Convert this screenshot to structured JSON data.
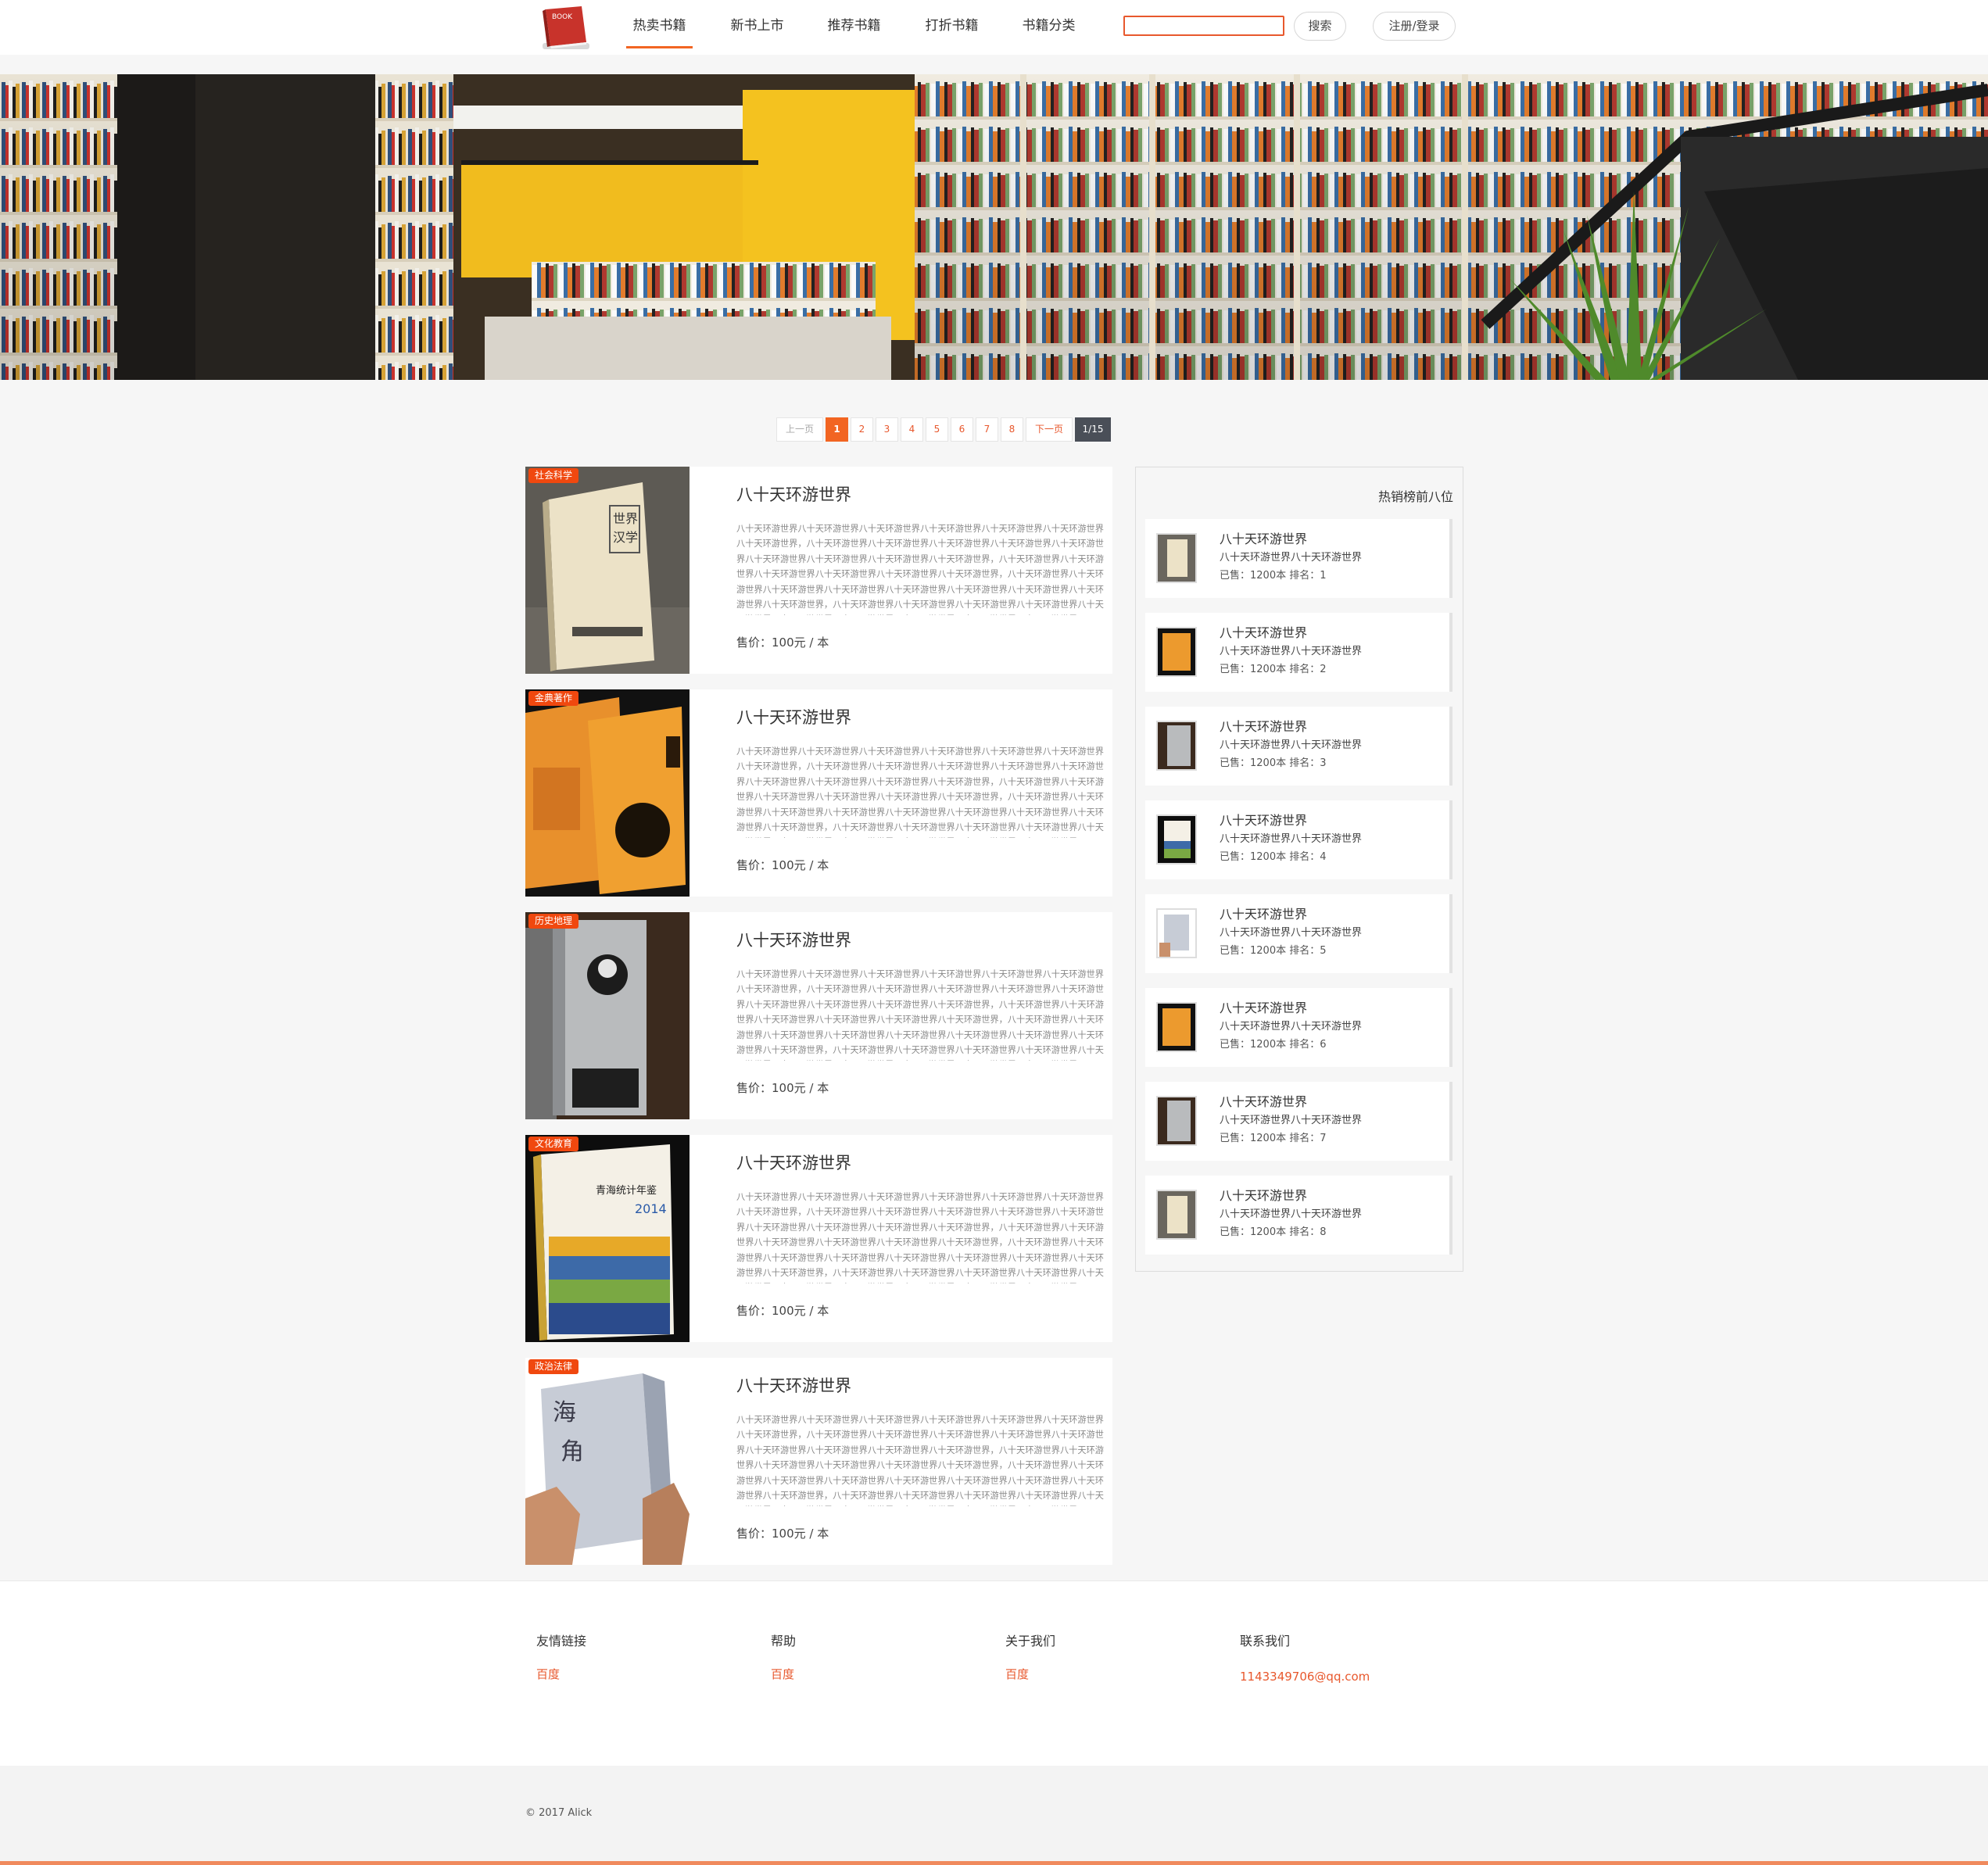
{
  "header": {
    "logo_text": "BOOK",
    "nav": [
      {
        "label": "热卖书籍",
        "active": true
      },
      {
        "label": "新书上市",
        "active": false
      },
      {
        "label": "推荐书籍",
        "active": false
      },
      {
        "label": "打折书籍",
        "active": false
      },
      {
        "label": "书籍分类",
        "active": false
      }
    ],
    "search": {
      "value": "",
      "placeholder": "",
      "button_label": "搜索"
    },
    "login_label": "注册/登录"
  },
  "pagination": {
    "prev_label": "上一页",
    "pages": [
      "1",
      "2",
      "3",
      "4",
      "5",
      "6",
      "7",
      "8"
    ],
    "current": "1",
    "next_label": "下一页",
    "total_label": "1/15"
  },
  "books": [
    {
      "category": "社会科学",
      "title": "八十天环游世界",
      "description": "八十天环游世界八十天环游世界八十天环游世界八十天环游世界八十天环游世界八十天环游世界八十天环游世界，八十天环游世界八十天环游世界八十天环游世界八十天环游世界八十天环游世界八十天环游世界八十天环游世界八十天环游世界八十天环游世界，八十天环游世界八十天环游世界八十天环游世界八十天环游世界八十天环游世界八十天环游世界，八十天环游世界八十天环游世界八十天环游世界八十天环游世界八十天环游世界八十天环游世界八十天环游世界八十天环游世界八十天环游世界，八十天环游世界八十天环游世界八十天环游世界八十天环游世界八十天环游世界八十天环游世界八十天环游世界八十天环游世界八十天环游世界八十天环游世界。",
      "price": "售价：100元 / 本"
    },
    {
      "category": "金典著作",
      "title": "八十天环游世界",
      "description": "八十天环游世界八十天环游世界八十天环游世界八十天环游世界八十天环游世界八十天环游世界八十天环游世界，八十天环游世界八十天环游世界八十天环游世界八十天环游世界八十天环游世界八十天环游世界八十天环游世界八十天环游世界八十天环游世界，八十天环游世界八十天环游世界八十天环游世界八十天环游世界八十天环游世界八十天环游世界，八十天环游世界八十天环游世界八十天环游世界八十天环游世界八十天环游世界八十天环游世界八十天环游世界八十天环游世界八十天环游世界，八十天环游世界八十天环游世界八十天环游世界八十天环游世界八十天环游世界八十天环游世界八十天环游世界八十天环游世界八十天环游世界八十天环游世界。",
      "price": "售价：100元 / 本"
    },
    {
      "category": "历史地理",
      "title": "八十天环游世界",
      "description": "八十天环游世界八十天环游世界八十天环游世界八十天环游世界八十天环游世界八十天环游世界八十天环游世界，八十天环游世界八十天环游世界八十天环游世界八十天环游世界八十天环游世界八十天环游世界八十天环游世界八十天环游世界八十天环游世界，八十天环游世界八十天环游世界八十天环游世界八十天环游世界八十天环游世界八十天环游世界，八十天环游世界八十天环游世界八十天环游世界八十天环游世界八十天环游世界八十天环游世界八十天环游世界八十天环游世界八十天环游世界，八十天环游世界八十天环游世界八十天环游世界八十天环游世界八十天环游世界八十天环游世界八十天环游世界八十天环游世界八十天环游世界八十天环游世界。",
      "price": "售价：100元 / 本"
    },
    {
      "category": "文化教育",
      "title": "八十天环游世界",
      "description": "八十天环游世界八十天环游世界八十天环游世界八十天环游世界八十天环游世界八十天环游世界八十天环游世界，八十天环游世界八十天环游世界八十天环游世界八十天环游世界八十天环游世界八十天环游世界八十天环游世界八十天环游世界八十天环游世界，八十天环游世界八十天环游世界八十天环游世界八十天环游世界八十天环游世界八十天环游世界，八十天环游世界八十天环游世界八十天环游世界八十天环游世界八十天环游世界八十天环游世界八十天环游世界八十天环游世界八十天环游世界，八十天环游世界八十天环游世界八十天环游世界八十天环游世界八十天环游世界八十天环游世界八十天环游世界八十天环游世界八十天环游世界八十天环游世界。",
      "price": "售价：100元 / 本"
    },
    {
      "category": "政治法律",
      "title": "八十天环游世界",
      "description": "八十天环游世界八十天环游世界八十天环游世界八十天环游世界八十天环游世界八十天环游世界八十天环游世界，八十天环游世界八十天环游世界八十天环游世界八十天环游世界八十天环游世界八十天环游世界八十天环游世界八十天环游世界八十天环游世界，八十天环游世界八十天环游世界八十天环游世界八十天环游世界八十天环游世界八十天环游世界，八十天环游世界八十天环游世界八十天环游世界八十天环游世界八十天环游世界八十天环游世界八十天环游世界八十天环游世界八十天环游世界，八十天环游世界八十天环游世界八十天环游世界八十天环游世界八十天环游世界八十天环游世界八十天环游世界八十天环游世界八十天环游世界八十天环游世界。",
      "price": "售价：100元 / 本"
    }
  ],
  "sidebar": {
    "title": "热销榜前八位",
    "items": [
      {
        "title": "八十天环游世界",
        "subtitle": "八十天环游世界八十天环游世界",
        "meta": "已售：1200本   排名：1"
      },
      {
        "title": "八十天环游世界",
        "subtitle": "八十天环游世界八十天环游世界",
        "meta": "已售：1200本   排名：2"
      },
      {
        "title": "八十天环游世界",
        "subtitle": "八十天环游世界八十天环游世界",
        "meta": "已售：1200本   排名：3"
      },
      {
        "title": "八十天环游世界",
        "subtitle": "八十天环游世界八十天环游世界",
        "meta": "已售：1200本   排名：4"
      },
      {
        "title": "八十天环游世界",
        "subtitle": "八十天环游世界八十天环游世界",
        "meta": "已售：1200本   排名：5"
      },
      {
        "title": "八十天环游世界",
        "subtitle": "八十天环游世界八十天环游世界",
        "meta": "已售：1200本   排名：6"
      },
      {
        "title": "八十天环游世界",
        "subtitle": "八十天环游世界八十天环游世界",
        "meta": "已售：1200本   排名：7"
      },
      {
        "title": "八十天环游世界",
        "subtitle": "八十天环游世界八十天环游世界",
        "meta": "已售：1200本   排名：8"
      }
    ]
  },
  "footer": {
    "columns": [
      {
        "title": "友情链接",
        "link": "百度"
      },
      {
        "title": "帮助",
        "link": "百度"
      },
      {
        "title": "关于我们",
        "link": "百度"
      },
      {
        "title": "联系我们",
        "link": "1143349706@qq.com"
      }
    ],
    "copyright": "© 2017 Alick"
  },
  "colors": {
    "accent": "#f26522",
    "badge": "#f0480f",
    "link": "#e8582d",
    "pager_total": "#4a4f58"
  }
}
